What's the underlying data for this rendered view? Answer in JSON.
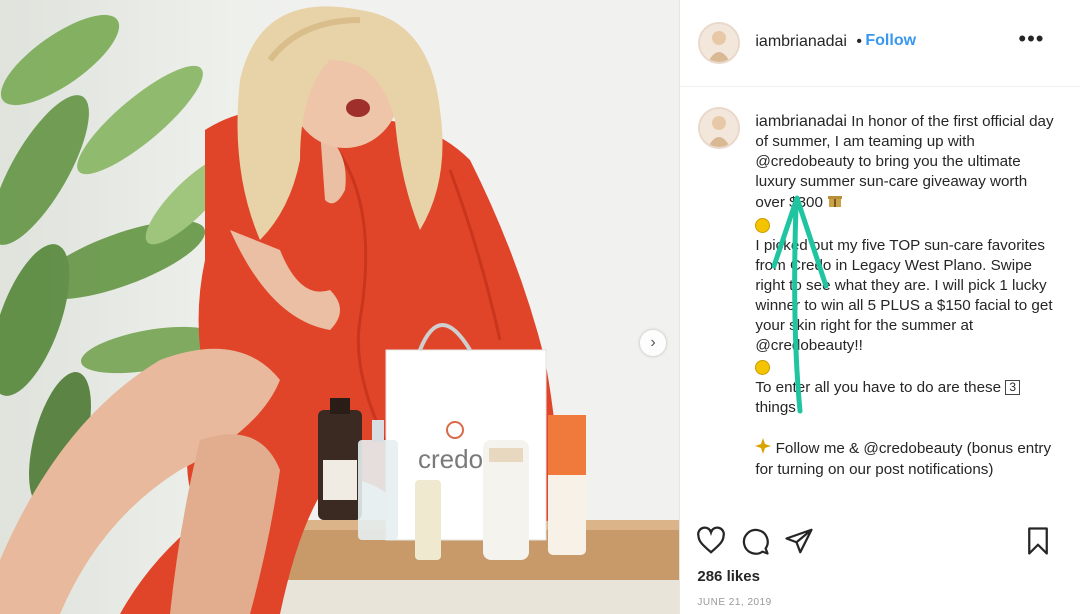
{
  "header": {
    "username": "iambrianadai",
    "separator": "•",
    "follow_label": "Follow",
    "more_label": "•••"
  },
  "caption": {
    "username": "iambrianadai",
    "line1": "In honor of the first official day of summer, I am teaming up with",
    "mention1": "@credobeauty",
    "line2": "to bring you the ultimate luxury summer sun-care giveaway worth over $300",
    "line3": "I picked out my five TOP sun-care favorites from Credo in Legacy West Plano. Swipe right to see what they are. I will pick 1 lucky winner to win all 5 PLUS a $150 facial to get your skin right for the summer at",
    "mention2": "@credobeauty!!",
    "line4a": "To enter all you have to do are these",
    "box_number": "3",
    "line4b": "things",
    "follow_line_a": "Follow me &",
    "mention3": "@credobeauty",
    "follow_line_b": "(bonus entry for turning on our post notifications)"
  },
  "product": {
    "brand": "credo"
  },
  "footer": {
    "likes": "286 likes",
    "date": "JUNE 21, 2019"
  },
  "colors": {
    "follow": "#3897f0",
    "dress": "#e0452a",
    "annotation_arrow": "#1fc5a0"
  },
  "icons": [
    "heart-icon",
    "comment-icon",
    "share-icon",
    "bookmark-icon",
    "more-icon",
    "chevron-right-icon"
  ]
}
